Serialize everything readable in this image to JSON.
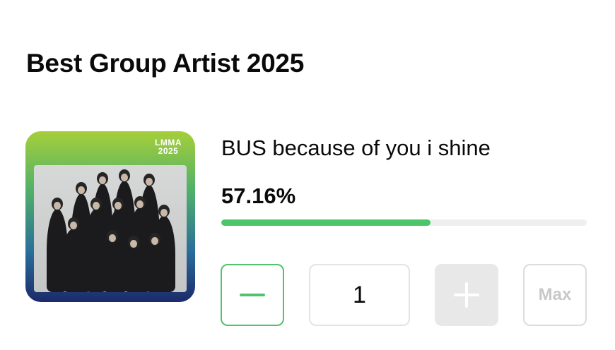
{
  "section": {
    "title": "Best Group Artist 2025"
  },
  "artist": {
    "name": "BUS because of you i shine",
    "percent_label": "57.16%",
    "progress_fraction": 0.5716,
    "thumbnail": {
      "badge_line1": "LMMA",
      "badge_line2": "2025"
    }
  },
  "vote_controls": {
    "quantity_value": "1",
    "max_label": "Max"
  },
  "colors": {
    "accent_green": "#4cc46a",
    "disabled_gray": "#e8e8e8"
  }
}
